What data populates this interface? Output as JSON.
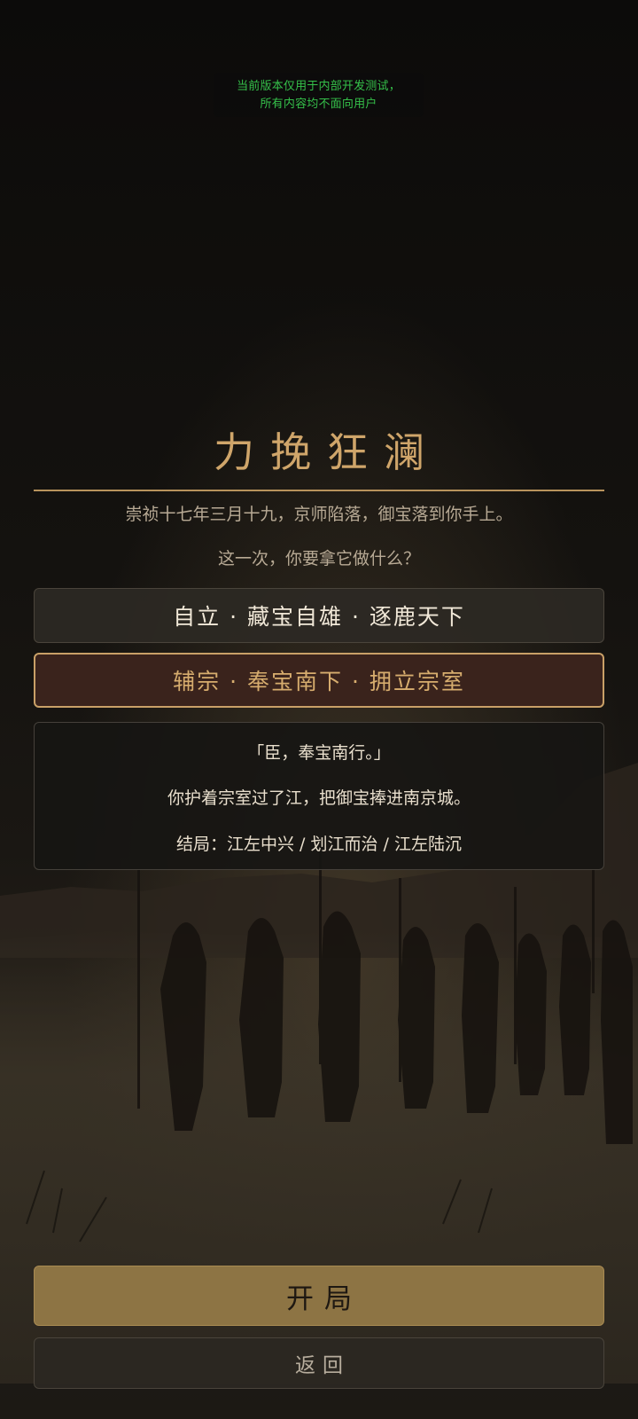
{
  "dev_banner": {
    "line1": "当前版本仅用于内部开发测试，",
    "line2": "所有内容均不面向用户"
  },
  "title": "力挽狂澜",
  "subtitle": "崇祯十七年三月十九，京师陷落，御宝落到你手上。",
  "question": "这一次，你要拿它做什么？",
  "options": [
    {
      "label": "自立 · 藏宝自雄 · 逐鹿天下",
      "selected": false
    },
    {
      "label": "辅宗 · 奉宝南下 · 拥立宗室",
      "selected": true
    }
  ],
  "detail": {
    "quote": "「臣，奉宝南行。」",
    "description": "你护着宗室过了江，把御宝捧进南京城。",
    "ending": "结局：江左中兴 / 划江而治 / 江左陆沉"
  },
  "buttons": {
    "start": "开局",
    "back": "返回"
  },
  "colors": {
    "accent_gold": "#cfa56a",
    "start_button": "#8d7444",
    "selected_option_bg": "#3a231c",
    "dev_banner_text": "#35c04a"
  }
}
